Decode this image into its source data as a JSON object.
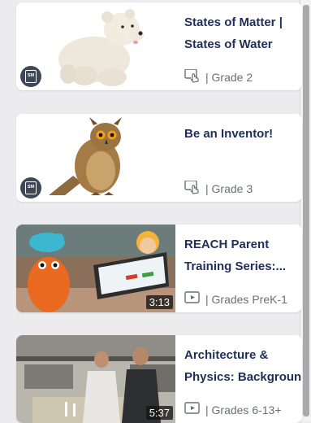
{
  "cards": [
    {
      "title_line1": "States of Matter |",
      "title_line2": "States of Water",
      "meta": "| Grade 2",
      "meta_icon": "interactive-hand-icon",
      "badge": "SM",
      "thumb": "polar-bear-cub"
    },
    {
      "title_line1": "Be an Inventor!",
      "title_line2": "",
      "meta": "| Grade 3",
      "meta_icon": "interactive-hand-icon",
      "badge": "SM",
      "thumb": "eagle-owl"
    },
    {
      "title_line1": "REACH Parent",
      "title_line2": "Training Series:...",
      "meta": "| Grades PreK-1",
      "meta_icon": "video-play-icon",
      "duration": "3:13",
      "thumb": "puppets-laptop"
    },
    {
      "title_line1": "Architecture &",
      "title_line2": "Physics: Backgroun",
      "meta": "| Grades 6-13+",
      "meta_icon": "video-play-icon",
      "duration": "5:37",
      "thumb": "lab-scene"
    }
  ],
  "colors": {
    "title": "#1f2f56",
    "meta": "#6b6f79",
    "badge": "#3f4756",
    "background": "#ececee"
  }
}
